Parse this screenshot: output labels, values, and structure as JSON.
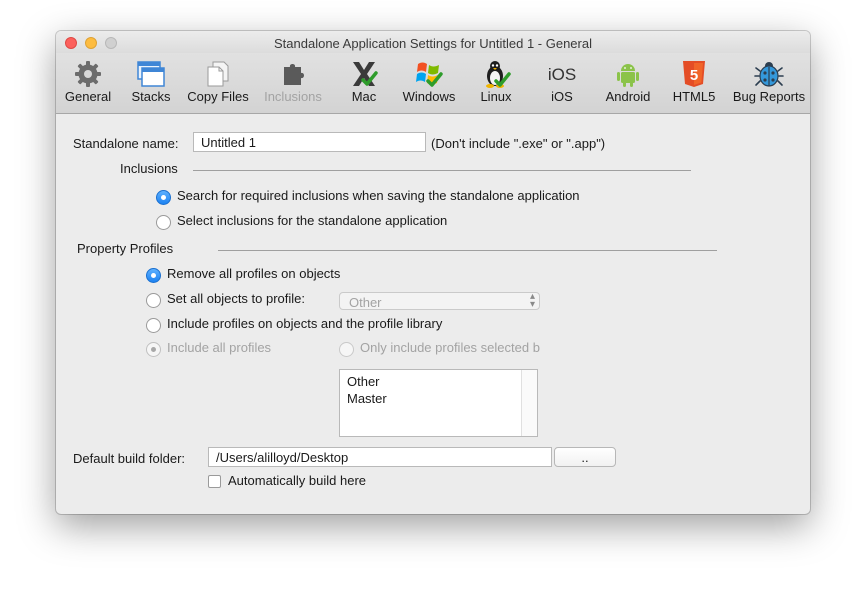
{
  "window": {
    "title": "Standalone Application Settings for Untitled 1 - General"
  },
  "toolbar": {
    "items": [
      {
        "label": "General",
        "icon": "gear-icon"
      },
      {
        "label": "Stacks",
        "icon": "stacks-icon"
      },
      {
        "label": "Copy Files",
        "icon": "copy-files-icon"
      },
      {
        "label": "Inclusions",
        "icon": "puzzle-icon",
        "disabled": true
      },
      {
        "label": "Mac",
        "icon": "mac-x-icon"
      },
      {
        "label": "Windows",
        "icon": "windows-flag-icon"
      },
      {
        "label": "Linux",
        "icon": "linux-penguin-icon"
      },
      {
        "label": "iOS",
        "icon": "ios-icon",
        "icon_text": "iOS"
      },
      {
        "label": "Android",
        "icon": "android-icon"
      },
      {
        "label": "HTML5",
        "icon": "html5-icon",
        "icon_text": "5"
      },
      {
        "label": "Bug Reports",
        "icon": "bug-icon"
      }
    ]
  },
  "general": {
    "standalone_name_label": "Standalone name:",
    "standalone_name_value": "Untitled 1",
    "standalone_name_hint": "(Don't include \".exe\" or \".app\")",
    "inclusions_heading": "Inclusions",
    "inclusions_options": [
      {
        "label": "Search for required inclusions when saving the standalone application",
        "selected": true
      },
      {
        "label": "Select inclusions for the standalone application",
        "selected": false
      }
    ],
    "profiles_heading": "Property Profiles",
    "profile_options": {
      "remove_all": {
        "label": "Remove all profiles on objects",
        "selected": true
      },
      "set_all": {
        "label": "Set all objects to profile:",
        "selected": false,
        "popup_value": "Other"
      },
      "include": {
        "label": "Include profiles on objects and the profile library",
        "selected": false
      },
      "include_all": {
        "label": "Include all profiles",
        "selected": true,
        "disabled": true
      },
      "include_selected": {
        "label": "Only include profiles selected b",
        "selected": false,
        "disabled": true
      }
    },
    "profile_list": [
      "Other",
      "Master"
    ],
    "build_folder_label": "Default build folder:",
    "build_folder_value": "/Users/alilloyd/Desktop",
    "browse_button": "..",
    "auto_build_label": "Automatically build here",
    "auto_build_checked": false
  },
  "colors": {
    "accent_blue": "#1d82f2",
    "close_red": "#fc605c",
    "minimize_yellow": "#fdbc40",
    "android_green": "#8bc34a",
    "html5_orange": "#e44d26",
    "check_green": "#2e9c2b"
  }
}
